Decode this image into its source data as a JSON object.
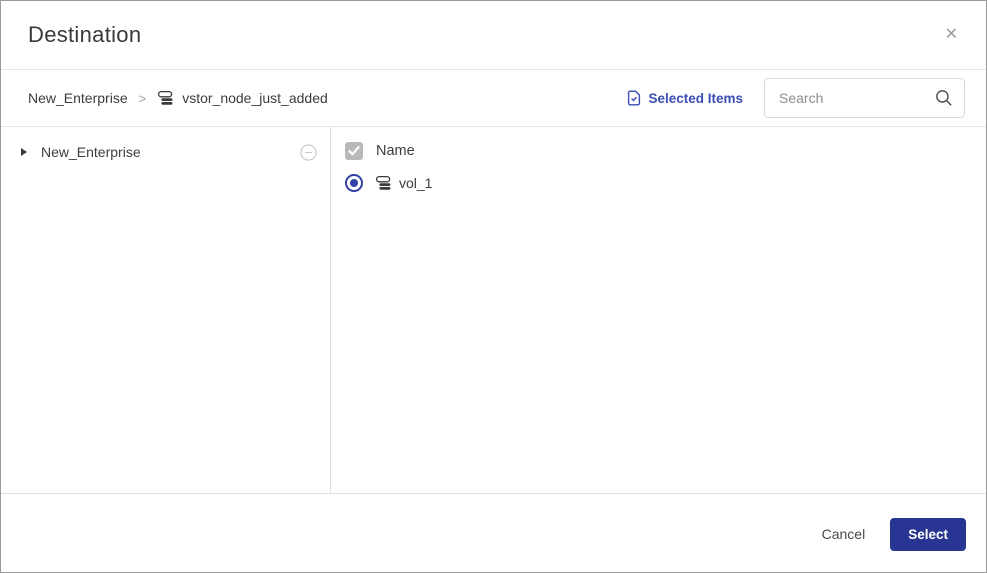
{
  "colors": {
    "accent": "#3a4db5",
    "primary_button_bg": "#283593",
    "primary_button_text": "#ffffff",
    "radio_selected": "#3241a5",
    "checkbox_disabled_bg": "#b9b9b9",
    "border_light": "#e6e6e6",
    "border_outer": "#9b9b9b",
    "text_dark": "#3d3d3d",
    "text_muted": "#8d8d8d"
  },
  "dialog": {
    "title": "Destination",
    "close_glyph": "✕"
  },
  "toolbar": {
    "breadcrumb": {
      "separator_glyph": ">",
      "items": [
        {
          "label": "New_Enterprise"
        },
        {
          "label": "vstor_node_just_added",
          "icon": "database-stack-icon"
        }
      ]
    },
    "selected_items": {
      "label": "Selected Items",
      "icon": "document-check-icon"
    },
    "search": {
      "placeholder": "Search",
      "value": "",
      "icon": "magnifier-icon"
    }
  },
  "tree": {
    "items": [
      {
        "label": "New_Enterprise",
        "state": "collapsed",
        "action_icon": "minus-circle-icon"
      }
    ]
  },
  "table": {
    "header": {
      "label": "Name",
      "checkbox": {
        "checked": true,
        "disabled": true
      }
    },
    "rows": [
      {
        "label": "vol_1",
        "icon": "database-stack-icon",
        "selected": true
      }
    ]
  },
  "footer": {
    "cancel_label": "Cancel",
    "select_label": "Select"
  }
}
